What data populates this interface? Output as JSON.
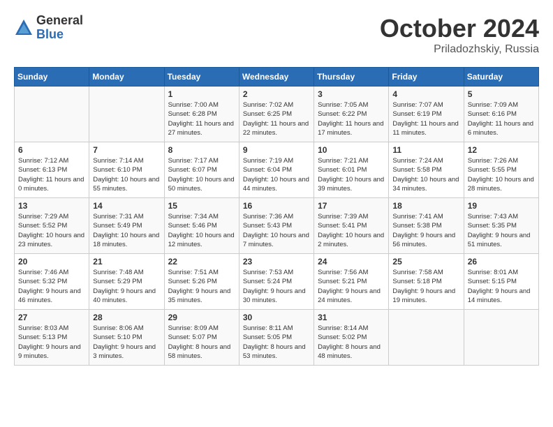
{
  "logo": {
    "general": "General",
    "blue": "Blue"
  },
  "title": {
    "month": "October 2024",
    "location": "Priladozhskiy, Russia"
  },
  "headers": [
    "Sunday",
    "Monday",
    "Tuesday",
    "Wednesday",
    "Thursday",
    "Friday",
    "Saturday"
  ],
  "weeks": [
    [
      {
        "day": "",
        "content": ""
      },
      {
        "day": "",
        "content": ""
      },
      {
        "day": "1",
        "content": "Sunrise: 7:00 AM\nSunset: 6:28 PM\nDaylight: 11 hours and 27 minutes."
      },
      {
        "day": "2",
        "content": "Sunrise: 7:02 AM\nSunset: 6:25 PM\nDaylight: 11 hours and 22 minutes."
      },
      {
        "day": "3",
        "content": "Sunrise: 7:05 AM\nSunset: 6:22 PM\nDaylight: 11 hours and 17 minutes."
      },
      {
        "day": "4",
        "content": "Sunrise: 7:07 AM\nSunset: 6:19 PM\nDaylight: 11 hours and 11 minutes."
      },
      {
        "day": "5",
        "content": "Sunrise: 7:09 AM\nSunset: 6:16 PM\nDaylight: 11 hours and 6 minutes."
      }
    ],
    [
      {
        "day": "6",
        "content": "Sunrise: 7:12 AM\nSunset: 6:13 PM\nDaylight: 11 hours and 0 minutes."
      },
      {
        "day": "7",
        "content": "Sunrise: 7:14 AM\nSunset: 6:10 PM\nDaylight: 10 hours and 55 minutes."
      },
      {
        "day": "8",
        "content": "Sunrise: 7:17 AM\nSunset: 6:07 PM\nDaylight: 10 hours and 50 minutes."
      },
      {
        "day": "9",
        "content": "Sunrise: 7:19 AM\nSunset: 6:04 PM\nDaylight: 10 hours and 44 minutes."
      },
      {
        "day": "10",
        "content": "Sunrise: 7:21 AM\nSunset: 6:01 PM\nDaylight: 10 hours and 39 minutes."
      },
      {
        "day": "11",
        "content": "Sunrise: 7:24 AM\nSunset: 5:58 PM\nDaylight: 10 hours and 34 minutes."
      },
      {
        "day": "12",
        "content": "Sunrise: 7:26 AM\nSunset: 5:55 PM\nDaylight: 10 hours and 28 minutes."
      }
    ],
    [
      {
        "day": "13",
        "content": "Sunrise: 7:29 AM\nSunset: 5:52 PM\nDaylight: 10 hours and 23 minutes."
      },
      {
        "day": "14",
        "content": "Sunrise: 7:31 AM\nSunset: 5:49 PM\nDaylight: 10 hours and 18 minutes."
      },
      {
        "day": "15",
        "content": "Sunrise: 7:34 AM\nSunset: 5:46 PM\nDaylight: 10 hours and 12 minutes."
      },
      {
        "day": "16",
        "content": "Sunrise: 7:36 AM\nSunset: 5:43 PM\nDaylight: 10 hours and 7 minutes."
      },
      {
        "day": "17",
        "content": "Sunrise: 7:39 AM\nSunset: 5:41 PM\nDaylight: 10 hours and 2 minutes."
      },
      {
        "day": "18",
        "content": "Sunrise: 7:41 AM\nSunset: 5:38 PM\nDaylight: 9 hours and 56 minutes."
      },
      {
        "day": "19",
        "content": "Sunrise: 7:43 AM\nSunset: 5:35 PM\nDaylight: 9 hours and 51 minutes."
      }
    ],
    [
      {
        "day": "20",
        "content": "Sunrise: 7:46 AM\nSunset: 5:32 PM\nDaylight: 9 hours and 46 minutes."
      },
      {
        "day": "21",
        "content": "Sunrise: 7:48 AM\nSunset: 5:29 PM\nDaylight: 9 hours and 40 minutes."
      },
      {
        "day": "22",
        "content": "Sunrise: 7:51 AM\nSunset: 5:26 PM\nDaylight: 9 hours and 35 minutes."
      },
      {
        "day": "23",
        "content": "Sunrise: 7:53 AM\nSunset: 5:24 PM\nDaylight: 9 hours and 30 minutes."
      },
      {
        "day": "24",
        "content": "Sunrise: 7:56 AM\nSunset: 5:21 PM\nDaylight: 9 hours and 24 minutes."
      },
      {
        "day": "25",
        "content": "Sunrise: 7:58 AM\nSunset: 5:18 PM\nDaylight: 9 hours and 19 minutes."
      },
      {
        "day": "26",
        "content": "Sunrise: 8:01 AM\nSunset: 5:15 PM\nDaylight: 9 hours and 14 minutes."
      }
    ],
    [
      {
        "day": "27",
        "content": "Sunrise: 8:03 AM\nSunset: 5:13 PM\nDaylight: 9 hours and 9 minutes."
      },
      {
        "day": "28",
        "content": "Sunrise: 8:06 AM\nSunset: 5:10 PM\nDaylight: 9 hours and 3 minutes."
      },
      {
        "day": "29",
        "content": "Sunrise: 8:09 AM\nSunset: 5:07 PM\nDaylight: 8 hours and 58 minutes."
      },
      {
        "day": "30",
        "content": "Sunrise: 8:11 AM\nSunset: 5:05 PM\nDaylight: 8 hours and 53 minutes."
      },
      {
        "day": "31",
        "content": "Sunrise: 8:14 AM\nSunset: 5:02 PM\nDaylight: 8 hours and 48 minutes."
      },
      {
        "day": "",
        "content": ""
      },
      {
        "day": "",
        "content": ""
      }
    ]
  ]
}
